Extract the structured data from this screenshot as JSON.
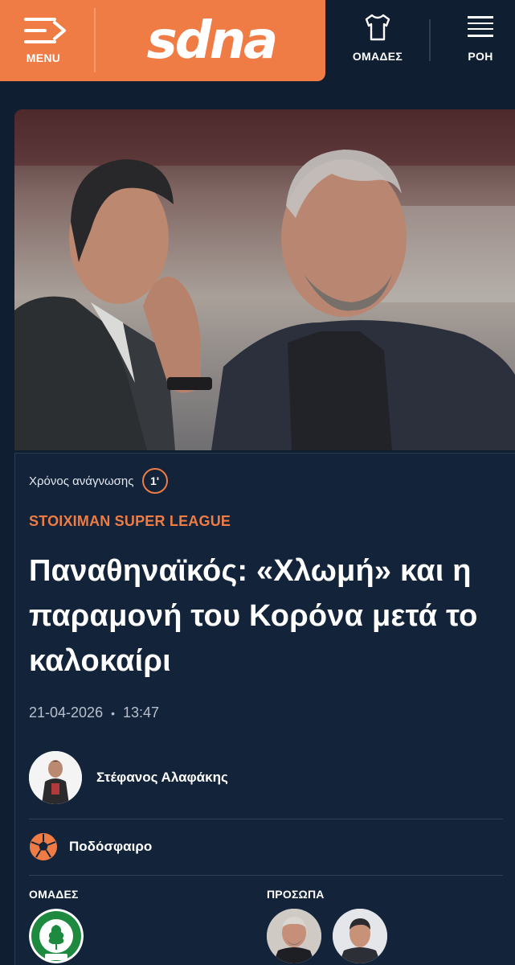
{
  "header": {
    "menu_label": "MENU",
    "logo_text": "SDNA",
    "teams_label": "ΟΜΑΔΕΣ",
    "feed_label": "ΡΟΗ",
    "brand_color": "#ef7b45"
  },
  "article": {
    "reading_time_label": "Χρόνος ανάγνωσης",
    "reading_time_value": "1'",
    "category": "STOIXIMAN SUPER LEAGUE",
    "title": "Παναθηναϊκός: «Χλωμή» και η παραμονή του Κορόνα μετά το καλοκαίρι",
    "date": "21-04-2026",
    "time": "13:47",
    "author": "Στέφανος Αλαφάκης",
    "sport": "Ποδόσφαιρο",
    "teams_section": "ΟΜΑΔΕΣ",
    "people_section": "ΠΡΟΣΩΠΑ"
  },
  "icons": {
    "menu": "menu-arrow-icon",
    "teams": "jersey-icon",
    "feed": "feed-lines-icon",
    "sport": "football-icon"
  }
}
